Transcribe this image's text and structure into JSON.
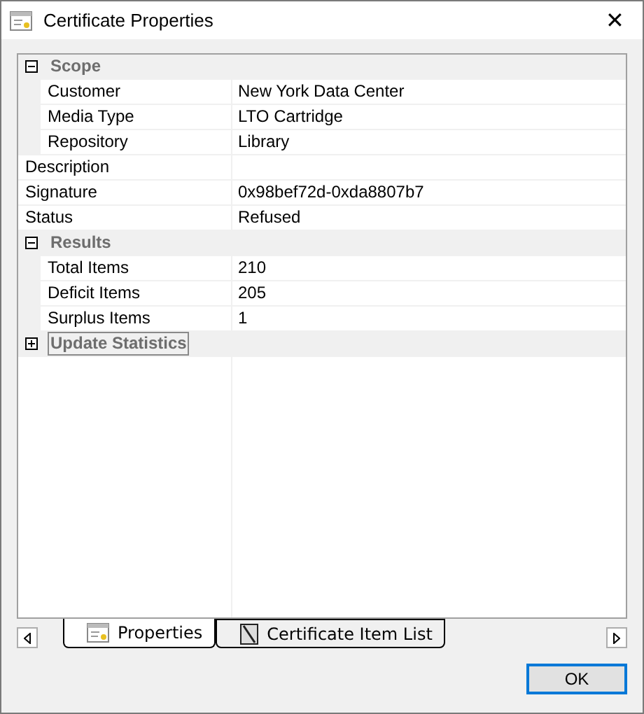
{
  "window": {
    "title": "Certificate Properties",
    "close": "✕"
  },
  "properties": [
    {
      "kind": "category",
      "name": "Scope",
      "expanded": true,
      "selected": false,
      "children": [
        {
          "kind": "property",
          "name": "Customer",
          "value": "New York Data Center"
        },
        {
          "kind": "property",
          "name": "Media Type",
          "value": "LTO Cartridge"
        },
        {
          "kind": "property",
          "name": "Repository",
          "value": "Library"
        }
      ]
    },
    {
      "kind": "property",
      "name": "Description"
    },
    {
      "kind": "property",
      "name": "Signature",
      "value": "0x98bef72d-0xda8807b7"
    },
    {
      "kind": "property",
      "name": "Status",
      "value": "Refused"
    },
    {
      "kind": "category",
      "name": "Results",
      "expanded": true,
      "selected": false,
      "children": [
        {
          "kind": "property",
          "name": "Total Items",
          "value": "210"
        },
        {
          "kind": "property",
          "name": "Deficit Items",
          "value": "205"
        },
        {
          "kind": "property",
          "name": "Surplus Items",
          "value": "1"
        }
      ]
    },
    {
      "kind": "category",
      "name": "Update Statistics",
      "expanded": false,
      "selected": true
    }
  ],
  "tabs": [
    {
      "label": "Properties",
      "selected": true,
      "kind": "properties"
    },
    {
      "label": "Certificate Item List",
      "selected": false,
      "kind": "list"
    }
  ],
  "buttons": [
    {
      "label": "OK",
      "default": true
    }
  ]
}
